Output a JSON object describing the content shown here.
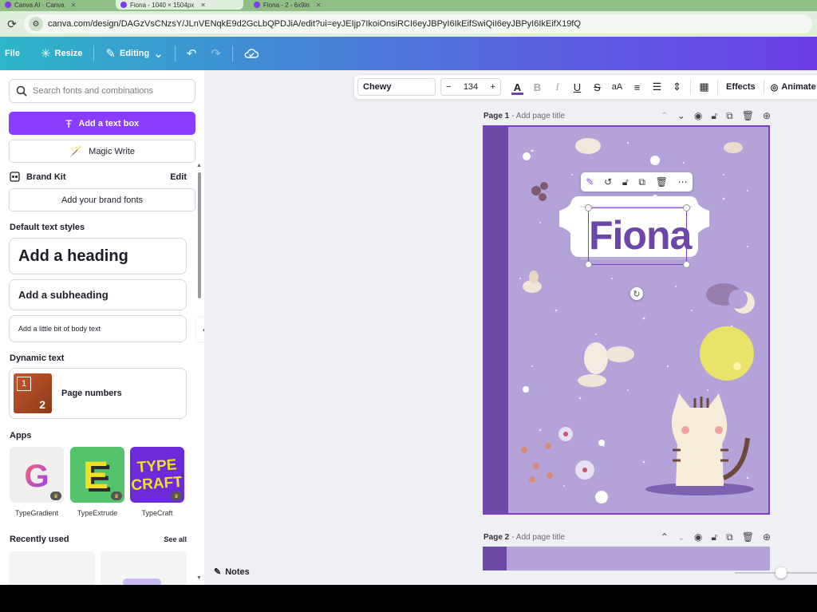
{
  "browser": {
    "tabs": [
      {
        "label": "Canva AI · Canva"
      },
      {
        "label": "Fiona - 1040 × 1504px"
      },
      {
        "label": "Fiona - 2 - 6x9in"
      }
    ],
    "url": "canva.com/design/DAGzVsCNzsY/JLnVENqkE9d2GcLbQPDJiA/edit?ui=eyJEIjp7IkoiOnsiRCI6eyJBPyI6IkEifSwiQiI6eyJBPyI6IkEifX19fQ"
  },
  "header": {
    "file": "File",
    "resize": "Resize",
    "editing": "Editing"
  },
  "sidebar": {
    "search_placeholder": "Search fonts and combinations",
    "add_text_box": "Add a text box",
    "magic_write": "Magic Write",
    "brand_kit": "Brand Kit",
    "brand_edit": "Edit",
    "add_brand_fonts": "Add your brand fonts",
    "default_styles": "Default text styles",
    "heading": "Add a heading",
    "subheading": "Add a subheading",
    "body": "Add a little bit of body text",
    "dynamic_text": "Dynamic text",
    "page_numbers": "Page numbers",
    "page_numbers_thumb": [
      "1",
      "2"
    ],
    "apps_label": "Apps",
    "apps": [
      {
        "name": "TypeGradient",
        "glyph": "G",
        "bg": "#f1eeee"
      },
      {
        "name": "TypeExtrude",
        "glyph": "E",
        "bg": "#55c36b"
      },
      {
        "name": "TypeCraft",
        "glyph": "TYPE CRAFT",
        "bg": "#6c2bd9"
      }
    ],
    "recently_used": "Recently used",
    "see_all": "See all"
  },
  "toolbar": {
    "font": "Chewy",
    "font_size": "134",
    "minus": "−",
    "plus": "+",
    "effects": "Effects",
    "animate": "Animate"
  },
  "pages": [
    {
      "label": "Page 1",
      "title_placeholder": "- Add page title"
    },
    {
      "label": "Page 2",
      "title_placeholder": "- Add page title"
    }
  ],
  "canvas": {
    "title_text": "Fiona",
    "page_bg": "#b3a3d9",
    "spine_color": "#6d4aa6",
    "text_color": "#6c46a8"
  },
  "footer": {
    "notes": "Notes"
  },
  "colors": {
    "brand_purple": "#8b3dff",
    "selection": "#7d3cc9"
  }
}
